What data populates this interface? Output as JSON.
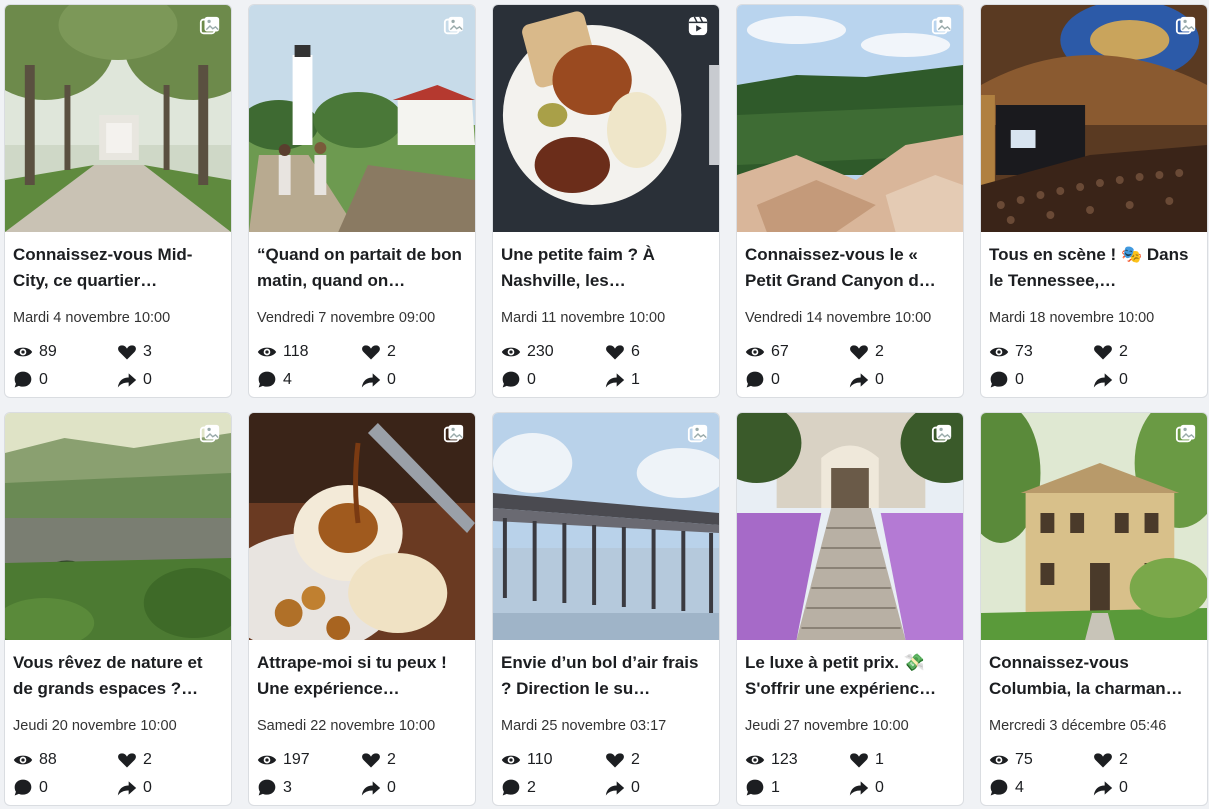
{
  "posts": [
    {
      "title": "Connaissez-vous Mid-City, ce quartier…",
      "date": "Mardi 4 novembre 10:00",
      "views": "89",
      "likes": "3",
      "comments": "0",
      "shares": "0",
      "media_type": "photo-album-icon"
    },
    {
      "title": "“Quand on partait de bon matin, quand on…",
      "date": "Vendredi 7 novembre 09:00",
      "views": "118",
      "likes": "2",
      "comments": "4",
      "shares": "0",
      "media_type": "photo-album-icon"
    },
    {
      "title": "Une petite faim ? À Nashville, les…",
      "date": "Mardi 11 novembre 10:00",
      "views": "230",
      "likes": "6",
      "comments": "0",
      "shares": "1",
      "media_type": "reel-icon"
    },
    {
      "title": "Connaissez-vous le « Petit Grand Canyon d…",
      "date": "Vendredi 14 novembre 10:00",
      "views": "67",
      "likes": "2",
      "comments": "0",
      "shares": "0",
      "media_type": "photo-album-icon"
    },
    {
      "title": "Tous en scène ! 🎭 Dans le Tennessee,…",
      "date": "Mardi 18 novembre 10:00",
      "views": "73",
      "likes": "2",
      "comments": "0",
      "shares": "0",
      "media_type": "photo-album-icon"
    },
    {
      "title": "Vous rêvez de nature et de grands espaces ?…",
      "date": "Jeudi 20 novembre 10:00",
      "views": "88",
      "likes": "2",
      "comments": "0",
      "shares": "0",
      "media_type": "photo-album-icon"
    },
    {
      "title": "Attrape-moi si tu peux ! Une expérience…",
      "date": "Samedi 22 novembre 10:00",
      "views": "197",
      "likes": "2",
      "comments": "3",
      "shares": "0",
      "media_type": "photo-album-icon"
    },
    {
      "title": "Envie d’un bol d’air frais ? Direction le su…",
      "date": "Mardi 25 novembre 03:17",
      "views": "110",
      "likes": "2",
      "comments": "2",
      "shares": "0",
      "media_type": "photo-album-icon"
    },
    {
      "title": "Le luxe à petit prix. 💸 S'offrir une expérienc…",
      "date": "Jeudi 27 novembre 10:00",
      "views": "123",
      "likes": "1",
      "comments": "1",
      "shares": "0",
      "media_type": "photo-album-icon"
    },
    {
      "title": "Connaissez-vous Columbia, la charman…",
      "date": "Mercredi 3 décembre 05:46",
      "views": "75",
      "likes": "2",
      "comments": "4",
      "shares": "0",
      "media_type": "photo-album-icon"
    }
  ],
  "icons": {
    "views": "eye-icon",
    "likes": "heart-icon",
    "comments": "comment-icon",
    "shares": "share-icon"
  },
  "colors": {
    "icon": "#1c1e21",
    "card_border": "#dadde1",
    "page_bg": "#f0f2f5"
  }
}
